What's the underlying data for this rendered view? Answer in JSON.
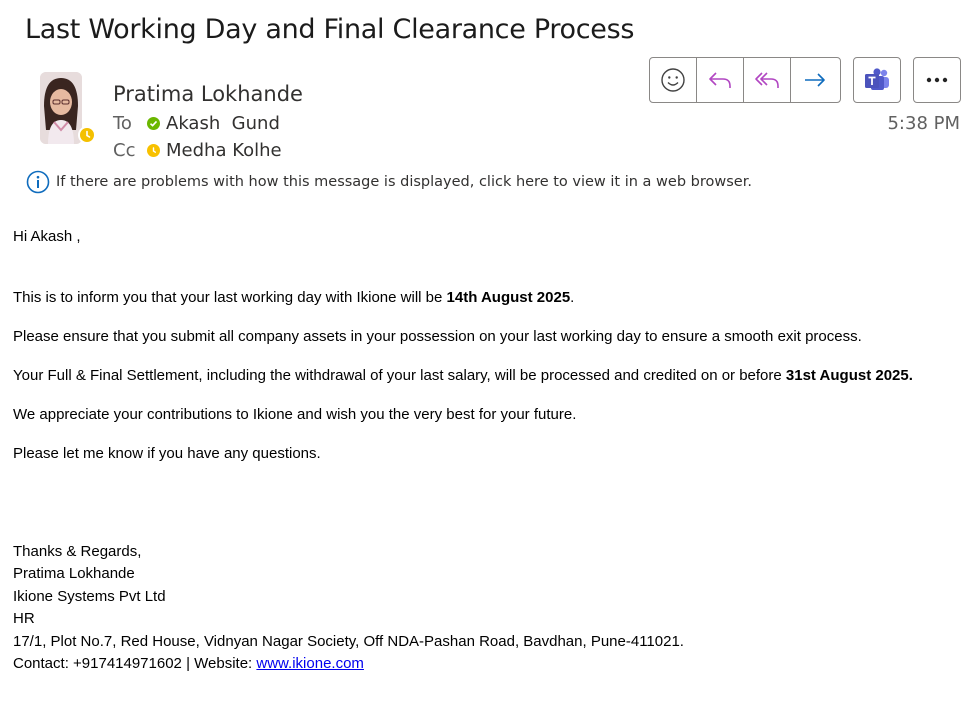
{
  "email": {
    "subject": "Last Working Day and Final Clearance Process",
    "sender": "Pratima Lokhande",
    "to_label": "To",
    "to_name": "Akash  Gund",
    "cc_label": "Cc",
    "cc_name": "Medha Kolhe",
    "time": "5:38 PM",
    "info_text": "If there are problems with how this message is displayed, click here to view it in a web browser."
  },
  "toolbar": {
    "icons": [
      "smiley-icon",
      "reply-icon",
      "reply-all-icon",
      "forward-icon",
      "teams-icon",
      "more-icon"
    ]
  },
  "colors": {
    "presence_available": "#6bb700",
    "presence_away": "#f8c100",
    "icon_purple": "#b146c2",
    "icon_blue": "#0f6cbd",
    "info_blue": "#0f6cbd"
  },
  "body": {
    "greeting": "Hi Akash ,",
    "p1_pre": "This is to inform you that your last working day with Ikione will be ",
    "p1_bold": "14th August 2025",
    "p1_post": ".",
    "p2": "Please ensure that you submit all company assets in your possession on  your last working day to ensure a smooth exit process.",
    "p3_pre": "Your Full & Final Settlement, including the withdrawal of your last salary, will be processed and credited on or before ",
    "p3_bold": "31st August 2025.",
    "p4": "We appreciate your contributions to Ikione and wish you the very best for your future.",
    "p5": "Please let me know if you have any questions."
  },
  "signature": {
    "closing": "Thanks & Regards,",
    "name": "Pratima Lokhande",
    "company": "Ikione Systems Pvt Ltd",
    "dept": "HR",
    "address": "17/1, Plot No.7, Red House, Vidnyan Nagar Society, Off NDA-Pashan Road, Bavdhan, Pune-411021.",
    "contact_pre": "Contact: +917414971602 | Website: ",
    "website": "www.ikione.com"
  }
}
